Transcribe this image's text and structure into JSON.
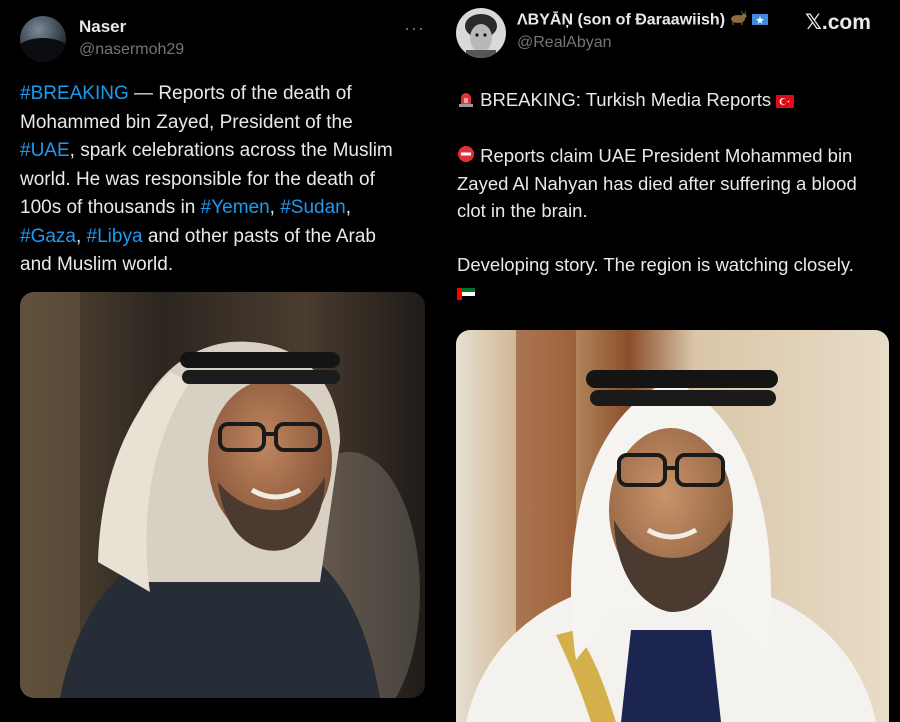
{
  "left": {
    "author_name": "Naser",
    "author_handle": "@nasermoh29",
    "more_label": "···",
    "text_lines": [
      [
        {
          "t": "#BREAKING",
          "h": true
        },
        {
          "t": " — Reports of the death of",
          "h": false
        }
      ],
      [
        {
          "t": "Mohammed bin Zayed, President of the",
          "h": false
        }
      ],
      [
        {
          "t": "#UAE",
          "h": true
        },
        {
          "t": ", spark celebrations across the Muslim",
          "h": false
        }
      ],
      [
        {
          "t": "world. He was responsible for the death of",
          "h": false
        }
      ],
      [
        {
          "t": "100s of thousands in ",
          "h": false
        },
        {
          "t": "#Yemen",
          "h": true
        },
        {
          "t": ", ",
          "h": false
        },
        {
          "t": "#Sudan",
          "h": true
        },
        {
          "t": ",",
          "h": false
        }
      ],
      [
        {
          "t": "#Gaza",
          "h": true
        },
        {
          "t": ", ",
          "h": false
        },
        {
          "t": "#Libya",
          "h": true
        },
        {
          "t": " and other pasts of the Arab",
          "h": false
        }
      ],
      [
        {
          "t": "and Muslim world.",
          "h": false
        }
      ]
    ]
  },
  "right": {
    "author_name": "ΛBYĀŅ (son of Ðaraawiish)",
    "author_handle": "@RealAbyan",
    "watermark": "𝕏.com",
    "line1": "BREAKING: Turkish Media Reports",
    "line2a": "Reports claim UAE President Mohammed bin",
    "line2b": "Zayed Al Nahyan has died after suffering a blood",
    "line2c": "clot in the brain.",
    "line3": "Developing story. The region is watching closely."
  },
  "colors": {
    "background": "#000000",
    "text": "#e7e9ea",
    "muted": "#71767b",
    "hashtag": "#1d9bf0"
  },
  "icons": [
    "siren-icon",
    "turkey-flag-icon",
    "no-entry-icon",
    "uae-flag-icon",
    "somalia-flag-icon",
    "goat-icon",
    "more-dots-icon"
  ]
}
